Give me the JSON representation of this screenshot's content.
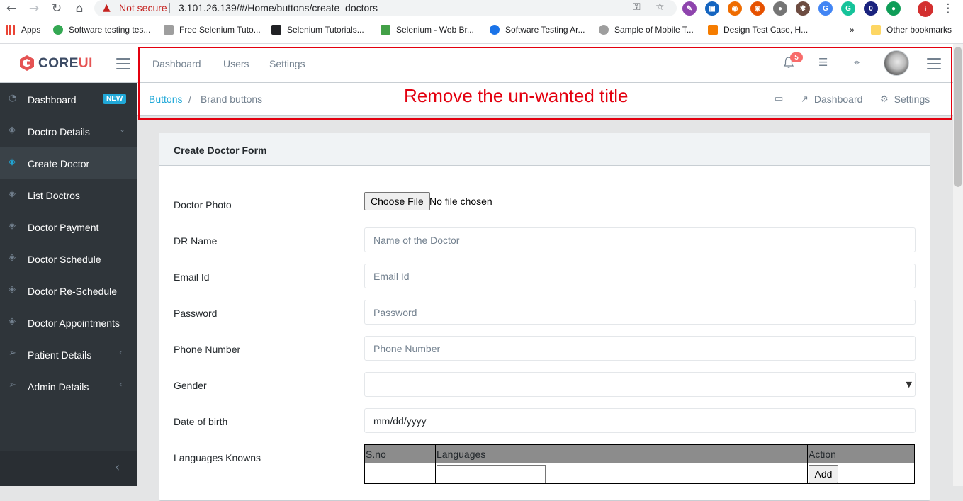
{
  "browser": {
    "security_label": "Not secure",
    "url": "3.101.26.139/#/Home/buttons/create_doctors",
    "bookmarks": [
      {
        "label": "Apps",
        "color": "#4285f4"
      },
      {
        "label": "Software testing tes...",
        "color": "#34a853"
      },
      {
        "label": "Free Selenium Tuto...",
        "color": "#5f6368"
      },
      {
        "label": "Selenium Tutorials...",
        "color": "#202124"
      },
      {
        "label": "Selenium - Web Br...",
        "color": "#43a047"
      },
      {
        "label": "Software Testing Ar...",
        "color": "#1a73e8"
      },
      {
        "label": "Sample of Mobile T...",
        "color": "#5f6368"
      },
      {
        "label": "Design Test Case, H...",
        "color": "#f57c00"
      }
    ],
    "more_bookmarks": "»",
    "other_bookmarks": "Other bookmarks"
  },
  "brand": {
    "name_prefix": "CORE",
    "name_suffix": "UI"
  },
  "sidebar": {
    "items": [
      {
        "label": "Dashboard",
        "badge": "NEW"
      },
      {
        "label": "Doctro Details",
        "chevron": "⌄"
      },
      {
        "label": "Create Doctor"
      },
      {
        "label": "List Doctros"
      },
      {
        "label": "Doctor Payment"
      },
      {
        "label": "Doctor Schedule"
      },
      {
        "label": "Doctor Re-Schedule"
      },
      {
        "label": "Doctor Appointments"
      },
      {
        "label": "Patient Details",
        "chevron": "‹"
      },
      {
        "label": "Admin Details",
        "chevron": "‹"
      }
    ]
  },
  "header": {
    "nav": [
      "Dashboard",
      "Users",
      "Settings"
    ],
    "notification_count": "5"
  },
  "breadcrumb": {
    "link": "Buttons",
    "separator": "/",
    "current": "Brand buttons"
  },
  "subheader_menu": {
    "dashboard": "Dashboard",
    "settings": "Settings"
  },
  "annotation": {
    "text": "Remove the un-wanted title"
  },
  "form": {
    "title": "Create Doctor Form",
    "photo_label": "Doctor Photo",
    "file_button": "Choose File",
    "file_status": "No file chosen",
    "fields": [
      {
        "label": "DR Name",
        "placeholder": "Name of the Doctor"
      },
      {
        "label": "Email Id",
        "placeholder": "Email Id"
      },
      {
        "label": "Password",
        "placeholder": "Password"
      },
      {
        "label": "Phone Number",
        "placeholder": "Phone Number"
      }
    ],
    "gender_label": "Gender",
    "gender_value": "",
    "dob_label": "Date of birth",
    "dob_placeholder": "mm/dd/yyyy",
    "languages_label": "Languages Knowns",
    "table_headers": [
      "S.no",
      "Languages",
      "Action"
    ],
    "add_button": "Add"
  },
  "colors": {
    "accent": "#20a8d8",
    "sidebar_bg": "#2f353a",
    "annotation": "#e3000f",
    "badge": "#f86c6b"
  }
}
